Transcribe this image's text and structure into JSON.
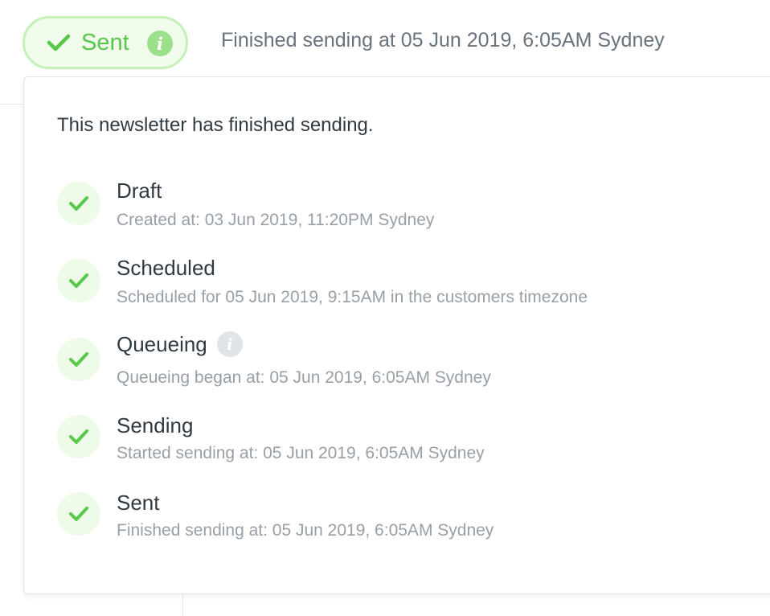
{
  "status": {
    "badge_label": "Sent",
    "summary": "Finished sending at 05 Jun 2019, 6:05AM Sydney",
    "accent_color": "#57c84a"
  },
  "popover": {
    "heading": "This newsletter has finished sending.",
    "steps": [
      {
        "title": "Draft",
        "description": "Created at: 03 Jun 2019, 11:20PM Sydney",
        "state": "done"
      },
      {
        "title": "Scheduled",
        "description": "Scheduled for 05 Jun 2019, 9:15AM in the customers timezone",
        "state": "done"
      },
      {
        "title": "Queueing",
        "description": "Queueing began at: 05 Jun 2019, 6:05AM Sydney",
        "state": "done",
        "has_info": true
      },
      {
        "title": "Sending",
        "description": "Started sending at: 05 Jun 2019, 6:05AM Sydney",
        "state": "done"
      },
      {
        "title": "Sent",
        "description": "Finished sending at: 05 Jun 2019, 6:05AM Sydney",
        "state": "done"
      }
    ]
  }
}
